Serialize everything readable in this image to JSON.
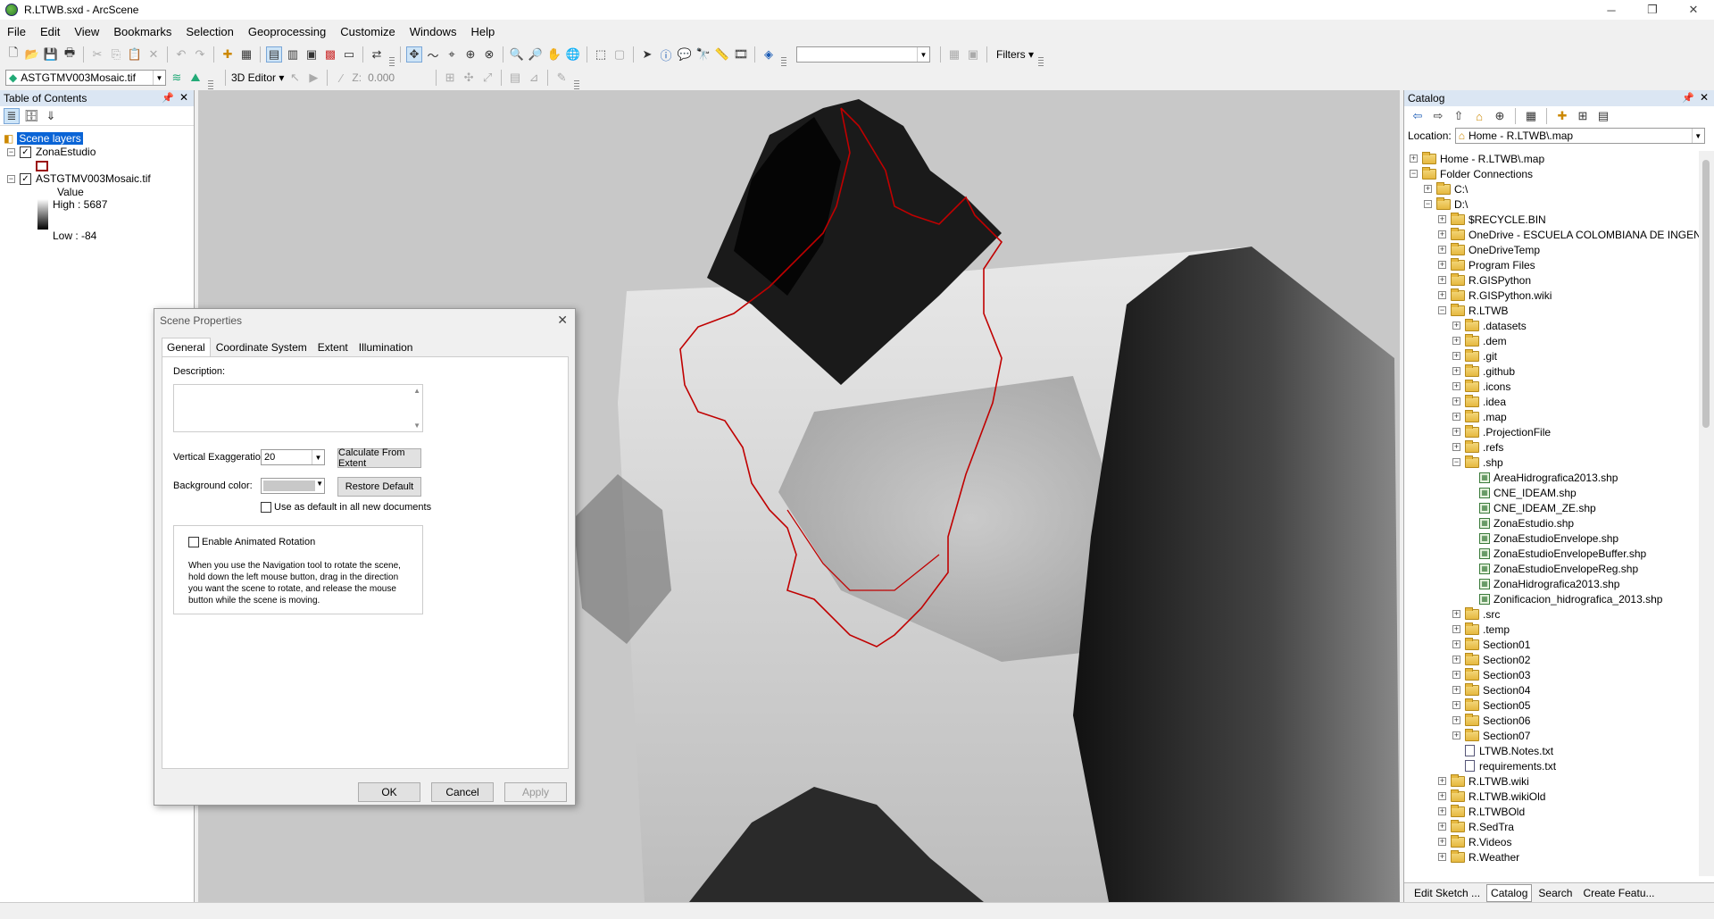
{
  "window": {
    "title": "R.LTWB.sxd - ArcScene",
    "controls": [
      "─",
      "❐",
      "✕"
    ]
  },
  "menu": [
    "File",
    "Edit",
    "View",
    "Bookmarks",
    "Selection",
    "Geoprocessing",
    "Customize",
    "Windows",
    "Help"
  ],
  "toolbar": {
    "layer_combo": "ASTGTMV003Mosaic.tif",
    "editor_label": "3D Editor ▾",
    "z_label": "Z:",
    "z_value": "0.000",
    "filters_label": "Filters ▾"
  },
  "toc": {
    "title": "Table of Contents",
    "root": "Scene layers",
    "layer1": "ZonaEstudio",
    "layer2": "ASTGTMV003Mosaic.tif",
    "legend_value": "Value",
    "high": "High : 5687",
    "low": "Low : -84"
  },
  "dialog": {
    "title": "Scene Properties",
    "tabs": [
      "General",
      "Coordinate System",
      "Extent",
      "Illumination"
    ],
    "description_label": "Description:",
    "vexag_label": "Vertical Exaggeration:",
    "vexag_value": "20",
    "calc_button": "Calculate From Extent",
    "bg_label": "Background color:",
    "restore_button": "Restore Default",
    "use_default": "Use as default in all new documents",
    "animated": "Enable Animated Rotation",
    "help_text": "When you use the Navigation tool to rotate the scene, hold down the left mouse button, drag in the direction you want the scene to rotate, and release the mouse button while the scene is moving.",
    "ok": "OK",
    "cancel": "Cancel",
    "apply": "Apply"
  },
  "catalog": {
    "title": "Catalog",
    "location_label": "Location:",
    "location_value": "Home - R.LTWB\\.map",
    "tree": [
      {
        "label": "Home - R.LTWB\\.map",
        "level": 0,
        "icon": "home",
        "exp": "+"
      },
      {
        "label": "Folder Connections",
        "level": 0,
        "icon": "folder",
        "exp": "-"
      },
      {
        "label": "C:\\",
        "level": 1,
        "icon": "folder",
        "exp": "+"
      },
      {
        "label": "D:\\",
        "level": 1,
        "icon": "folder",
        "exp": "-"
      },
      {
        "label": "$RECYCLE.BIN",
        "level": 2,
        "icon": "folder",
        "exp": "+"
      },
      {
        "label": "OneDrive - ESCUELA COLOMBIANA DE INGEN",
        "level": 2,
        "icon": "folder",
        "exp": "+"
      },
      {
        "label": "OneDriveTemp",
        "level": 2,
        "icon": "folder",
        "exp": "+"
      },
      {
        "label": "Program Files",
        "level": 2,
        "icon": "folder",
        "exp": "+"
      },
      {
        "label": "R.GISPython",
        "level": 2,
        "icon": "folder",
        "exp": "+"
      },
      {
        "label": "R.GISPython.wiki",
        "level": 2,
        "icon": "folder",
        "exp": "+"
      },
      {
        "label": "R.LTWB",
        "level": 2,
        "icon": "folder",
        "exp": "-"
      },
      {
        "label": ".datasets",
        "level": 3,
        "icon": "folder",
        "exp": "+"
      },
      {
        "label": ".dem",
        "level": 3,
        "icon": "folder",
        "exp": "+"
      },
      {
        "label": ".git",
        "level": 3,
        "icon": "folder",
        "exp": "+"
      },
      {
        "label": ".github",
        "level": 3,
        "icon": "folder",
        "exp": "+"
      },
      {
        "label": ".icons",
        "level": 3,
        "icon": "folder",
        "exp": "+"
      },
      {
        "label": ".idea",
        "level": 3,
        "icon": "folder",
        "exp": "+"
      },
      {
        "label": ".map",
        "level": 3,
        "icon": "folder",
        "exp": "+"
      },
      {
        "label": ".ProjectionFile",
        "level": 3,
        "icon": "folder",
        "exp": "+"
      },
      {
        "label": ".refs",
        "level": 3,
        "icon": "folder",
        "exp": "+"
      },
      {
        "label": ".shp",
        "level": 3,
        "icon": "folder",
        "exp": "-"
      },
      {
        "label": "AreaHidrografica2013.shp",
        "level": 4,
        "icon": "shp",
        "exp": ""
      },
      {
        "label": "CNE_IDEAM.shp",
        "level": 4,
        "icon": "shp",
        "exp": ""
      },
      {
        "label": "CNE_IDEAM_ZE.shp",
        "level": 4,
        "icon": "shp",
        "exp": ""
      },
      {
        "label": "ZonaEstudio.shp",
        "level": 4,
        "icon": "shp",
        "exp": ""
      },
      {
        "label": "ZonaEstudioEnvelope.shp",
        "level": 4,
        "icon": "shp",
        "exp": ""
      },
      {
        "label": "ZonaEstudioEnvelopeBuffer.shp",
        "level": 4,
        "icon": "shp",
        "exp": ""
      },
      {
        "label": "ZonaEstudioEnvelopeReg.shp",
        "level": 4,
        "icon": "shp",
        "exp": ""
      },
      {
        "label": "ZonaHidrografica2013.shp",
        "level": 4,
        "icon": "shp",
        "exp": ""
      },
      {
        "label": "Zonificacion_hidrografica_2013.shp",
        "level": 4,
        "icon": "shp",
        "exp": ""
      },
      {
        "label": ".src",
        "level": 3,
        "icon": "folder",
        "exp": "+"
      },
      {
        "label": ".temp",
        "level": 3,
        "icon": "folder",
        "exp": "+"
      },
      {
        "label": "Section01",
        "level": 3,
        "icon": "folder",
        "exp": "+"
      },
      {
        "label": "Section02",
        "level": 3,
        "icon": "folder",
        "exp": "+"
      },
      {
        "label": "Section03",
        "level": 3,
        "icon": "folder",
        "exp": "+"
      },
      {
        "label": "Section04",
        "level": 3,
        "icon": "folder",
        "exp": "+"
      },
      {
        "label": "Section05",
        "level": 3,
        "icon": "folder",
        "exp": "+"
      },
      {
        "label": "Section06",
        "level": 3,
        "icon": "folder",
        "exp": "+"
      },
      {
        "label": "Section07",
        "level": 3,
        "icon": "folder",
        "exp": "+"
      },
      {
        "label": "LTWB.Notes.txt",
        "level": 3,
        "icon": "txt",
        "exp": ""
      },
      {
        "label": "requirements.txt",
        "level": 3,
        "icon": "txt",
        "exp": ""
      },
      {
        "label": "R.LTWB.wiki",
        "level": 2,
        "icon": "folder",
        "exp": "+"
      },
      {
        "label": "R.LTWB.wikiOld",
        "level": 2,
        "icon": "folder",
        "exp": "+"
      },
      {
        "label": "R.LTWBOld",
        "level": 2,
        "icon": "folder",
        "exp": "+"
      },
      {
        "label": "R.SedTra",
        "level": 2,
        "icon": "folder",
        "exp": "+"
      },
      {
        "label": "R.Videos",
        "level": 2,
        "icon": "folder",
        "exp": "+"
      },
      {
        "label": "R.Weather",
        "level": 2,
        "icon": "folder",
        "exp": "+"
      }
    ],
    "tabs": [
      "Edit Sketch ...",
      "Catalog",
      "Search",
      "Create Featu..."
    ]
  },
  "colors": {
    "boundary": "#c00000",
    "scene_bg": "#c8c8c8",
    "selection": "#0a64d6"
  }
}
